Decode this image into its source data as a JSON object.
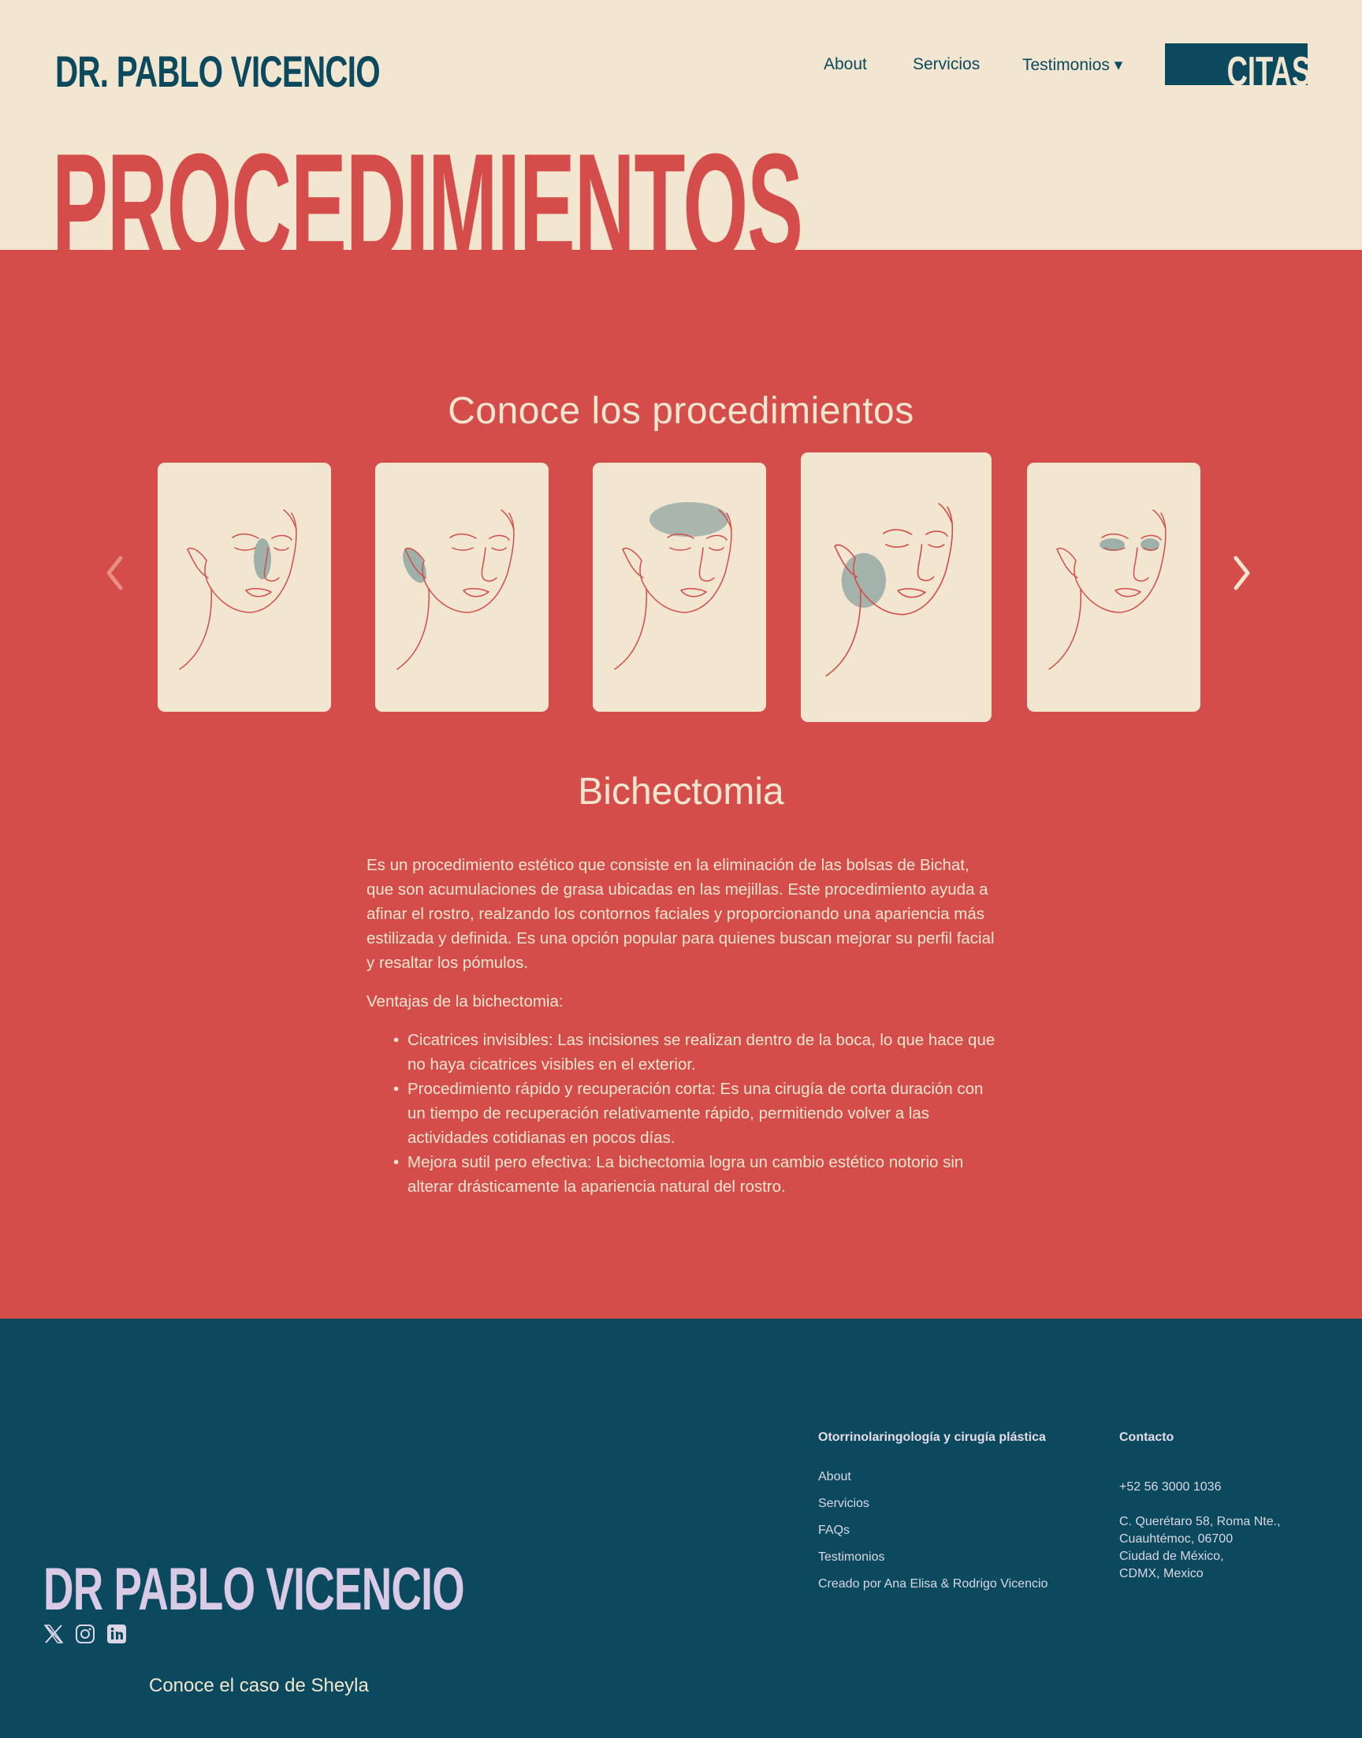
{
  "header": {
    "logo": "DR. PABLO VICENCIO",
    "nav": {
      "about": "About",
      "servicios": "Servicios",
      "testimonios": "Testimonios ▾"
    },
    "cta_label": "CITAS",
    "page_title": "PROCEDIMIENTOS"
  },
  "procedures": {
    "section_title": "Conoce los procedimientos",
    "carousel": {
      "prev_icon": "chevron-left-icon",
      "next_icon": "chevron-right-icon",
      "active_index": 3
    },
    "selected": {
      "title": "Bichectomia",
      "description": "Es un procedimiento estético que consiste en la eliminación de las bolsas de Bichat, que son acumulaciones de grasa ubicadas en las mejillas. Este procedimiento ayuda a afinar el rostro, realzando los contornos faciales y proporcionando una apariencia más estilizada y definida. Es una opción popular para quienes buscan mejorar su perfil facial y resaltar los pómulos.",
      "benefits_heading": "Ventajas de la bichectomia:",
      "benefits": [
        "Cicatrices invisibles: Las incisiones se realizan dentro de la boca, lo que hace que no haya cicatrices visibles en el exterior.",
        "Procedimiento rápido y recuperación corta: Es una cirugía de corta duración con un tiempo de recuperación relativamente rápido, permitiendo volver a las actividades cotidianas en pocos días.",
        "Mejora sutil pero efectiva: La bichectomia logra un cambio estético notorio sin alterar drásticamente la apariencia natural del rostro."
      ]
    }
  },
  "footer": {
    "col1_title": "Otorrinolaringología y cirugía plástica",
    "links": [
      "About",
      "Servicios",
      "FAQs",
      "Testimonios",
      "Creado por Ana Elisa & Rodrigo Vicencio"
    ],
    "col2_title": "Contacto",
    "phone": "+52 56 3000 1036",
    "address": [
      "C. Querétaro 58, Roma Nte.,",
      "Cuauhtémoc, 06700",
      "Ciudad de México,",
      "CDMX, Mexico"
    ],
    "logo": "DR PABLO VICENCIO",
    "social_icons": [
      "x-icon",
      "instagram-icon",
      "linkedin-icon"
    ],
    "case_link": "Conoce el caso de Sheyla"
  },
  "colors": {
    "cream": "#f2e6d0",
    "red": "#d44d4b",
    "navy": "#0b4a5e",
    "lavender": "#d9cbe6",
    "blob": "#8fa6a3"
  }
}
